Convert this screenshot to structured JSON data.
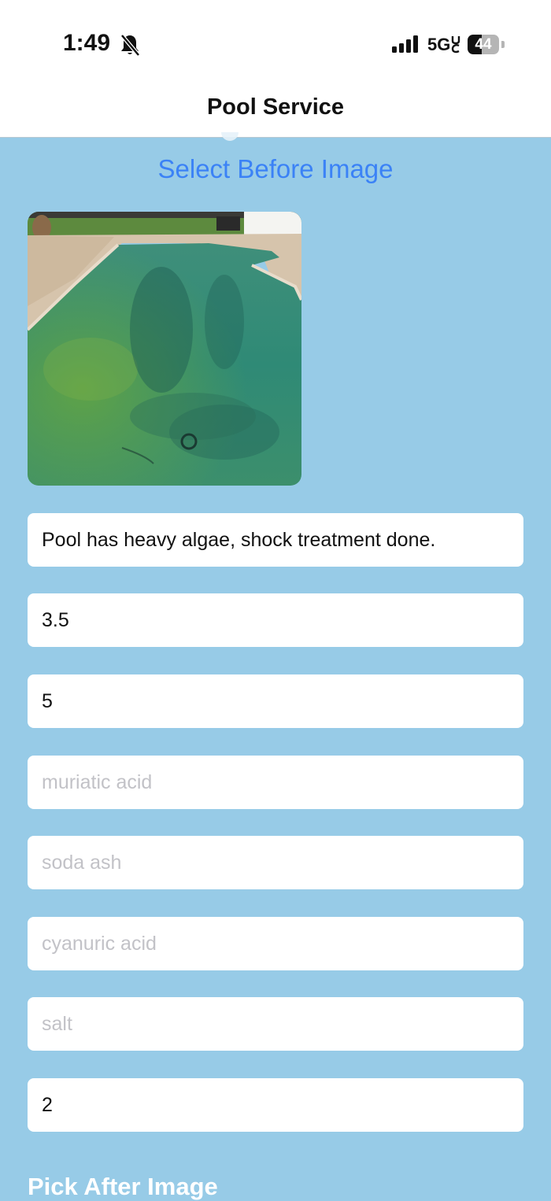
{
  "status_bar": {
    "time": "1:49",
    "network": "5G",
    "battery_percent": "44",
    "battery_level": 0.44,
    "icons": [
      "bell-slash-icon",
      "cellular-signal-icon",
      "uc-icon",
      "battery-icon"
    ]
  },
  "nav": {
    "title": "Pool Service"
  },
  "form": {
    "select_before_label": "Select Before Image",
    "before_image_alt": "Green algae pool photo",
    "notes_value": "Pool has heavy algae, shock treatment done.",
    "field2_value": "3.5",
    "field3_value": "5",
    "muriatic_acid_placeholder": "muriatic acid",
    "soda_ash_placeholder": "soda ash",
    "cyanuric_acid_placeholder": "cyanuric acid",
    "salt_placeholder": "salt",
    "field8_value": "2",
    "pick_after_label": "Pick After Image"
  },
  "colors": {
    "background": "#97cbe7",
    "link_blue": "#3b82f6",
    "placeholder": "#c2c2c7"
  }
}
